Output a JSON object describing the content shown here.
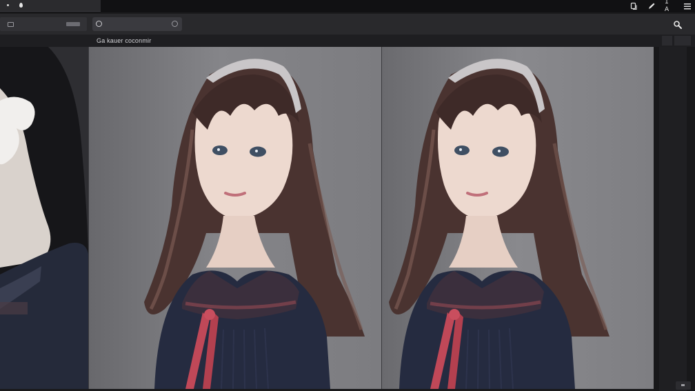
{
  "window": {
    "tab": {
      "icons": [
        "dot-icon",
        "drop-icon"
      ]
    },
    "title_icons": [
      "copy-icon",
      "pen-icon",
      "ia-text",
      "menu-icon"
    ],
    "title_text": "I A"
  },
  "toolbar": {
    "search": {
      "placeholder": ""
    },
    "icons": [
      "square-icon",
      "slider-pill",
      "circle-icon",
      "circle-clear-icon",
      "search-icon"
    ]
  },
  "caption": "Ga kauer coconmir",
  "viewer": {
    "panels": [
      {
        "name": "left-partial-image",
        "subject": "dark-haired figure"
      },
      {
        "name": "main-image-1",
        "subject": "girl with headband"
      },
      {
        "name": "main-image-2",
        "subject": "girl with headband"
      }
    ]
  },
  "colors": {
    "titlebar": "#111113",
    "toolbar": "#29292c",
    "viewer_bg": "#2a2a2c",
    "sidebar": "#18181a"
  }
}
